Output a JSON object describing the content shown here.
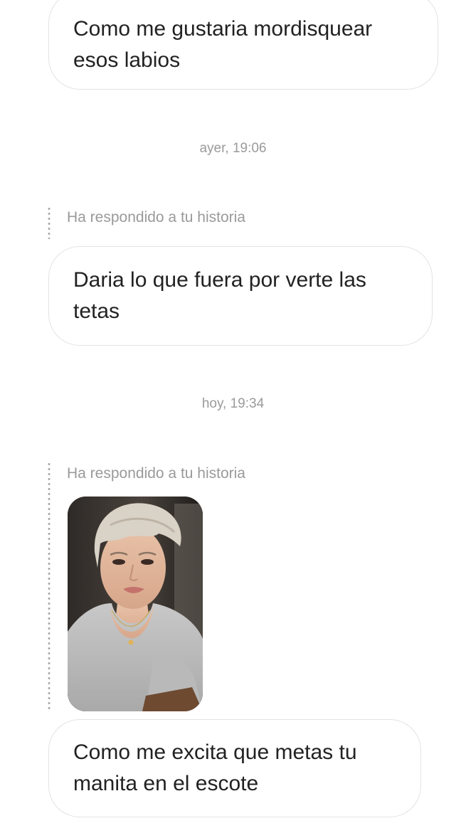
{
  "messages": [
    {
      "text": "Como me gustaria mordisquear esos labios"
    },
    {
      "timestamp": "ayer, 19:06"
    },
    {
      "reply_label": "Ha respondido a tu historia"
    },
    {
      "text": "Daria lo que fuera por verte las tetas"
    },
    {
      "timestamp": "hoy, 19:34"
    },
    {
      "reply_label": "Ha respondido a tu historia"
    },
    {
      "story_image": "story-photo-portrait"
    },
    {
      "text": "Como me excita que metas tu manita en el escote"
    }
  ],
  "colors": {
    "bubble_border": "#e3e3e3",
    "meta_text": "#9a9a9a",
    "message_text": "#222222"
  }
}
